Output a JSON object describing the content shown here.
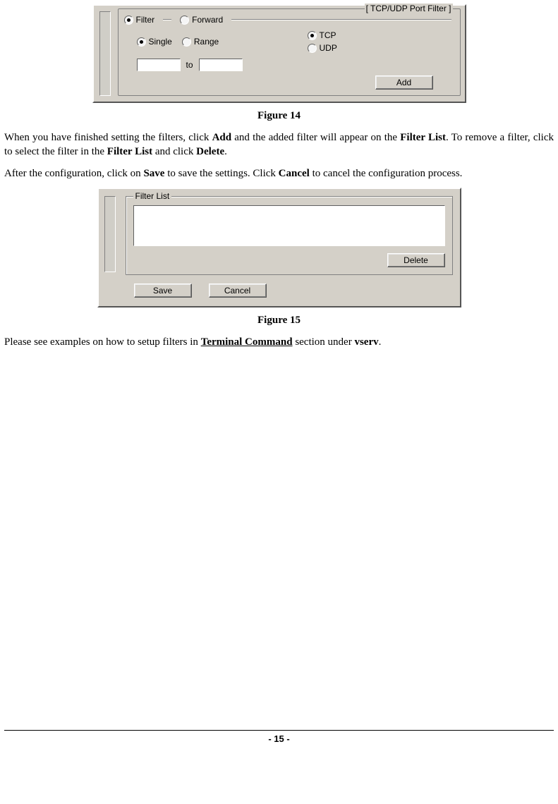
{
  "figure14": {
    "caption": "Figure 14",
    "groupbox_label": "[ TCP/UDP Port Filter ]",
    "radio_filter": "Filter",
    "radio_forward": "Forward",
    "radio_single": "Single",
    "radio_range": "Range",
    "radio_tcp": "TCP",
    "radio_udp": "UDP",
    "to_label": "to",
    "input_from_value": "",
    "input_to_value": "",
    "add_button": "Add"
  },
  "para1": {
    "t1": "When you have finished setting the filters, click ",
    "b1": "Add",
    "t2": " and the added filter will appear on the ",
    "b2": "Filter List",
    "t3": ". To remove a filter, click to select the filter in the ",
    "b3": "Filter List",
    "t4": " and click ",
    "b4": "Delete",
    "t5": "."
  },
  "para2": {
    "t1": "After the configuration, click on ",
    "b1": "Save",
    "t2": " to save the settings. Click ",
    "b2": "Cancel",
    "t3": " to cancel the configuration process."
  },
  "figure15": {
    "caption": "Figure 15",
    "legend": "Filter List",
    "delete_button": "Delete",
    "save_button": "Save",
    "cancel_button": "Cancel"
  },
  "para3": {
    "t1": "Please see examples on how to setup filters in ",
    "u1": "Terminal Command",
    "t2": " section under ",
    "b1": "vserv",
    "t3": "."
  },
  "footer": "- 15 -"
}
